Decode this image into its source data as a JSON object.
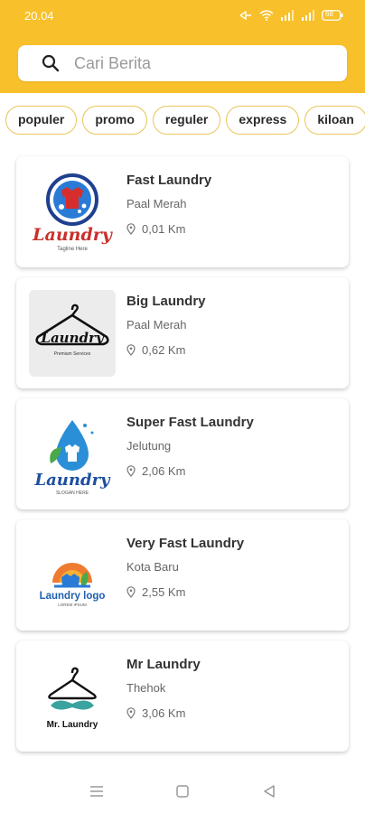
{
  "status_bar": {
    "time": "20.04",
    "icons": [
      "bluetooth-icon",
      "wifi-icon",
      "signal-icon",
      "signal-icon",
      "battery-icon"
    ],
    "battery_level": "68"
  },
  "search": {
    "placeholder": "Cari Berita"
  },
  "categories": [
    "populer",
    "promo",
    "reguler",
    "express",
    "kiloan"
  ],
  "laundries": [
    {
      "name": "Fast Laundry",
      "area": "Paal Merah",
      "distance": "0,01 Km",
      "logo_text": "Laundry",
      "logo_tagline": "Tagline Here"
    },
    {
      "name": "Big Laundry",
      "area": "Paal Merah",
      "distance": "0,62 Km",
      "logo_text": "Laundry",
      "logo_tagline": "Premium Services"
    },
    {
      "name": "Super Fast Laundry",
      "area": "Jelutung",
      "distance": "2,06 Km",
      "logo_text": "Laundry",
      "logo_tagline": "SLOGAN HERE"
    },
    {
      "name": "Very Fast Laundry",
      "area": "Kota Baru",
      "distance": "2,55 Km",
      "logo_text": "Laundry logo",
      "logo_tagline": "LOREM IPSUM"
    },
    {
      "name": "Mr Laundry",
      "area": "Thehok",
      "distance": "3,06 Km",
      "logo_text": "Mr. Laundry",
      "logo_tagline": ""
    }
  ],
  "nav": [
    "menu-icon",
    "home-square-icon",
    "back-triangle-icon"
  ],
  "colors": {
    "accent": "#f8c02a",
    "chip_border": "#e9c55a"
  }
}
